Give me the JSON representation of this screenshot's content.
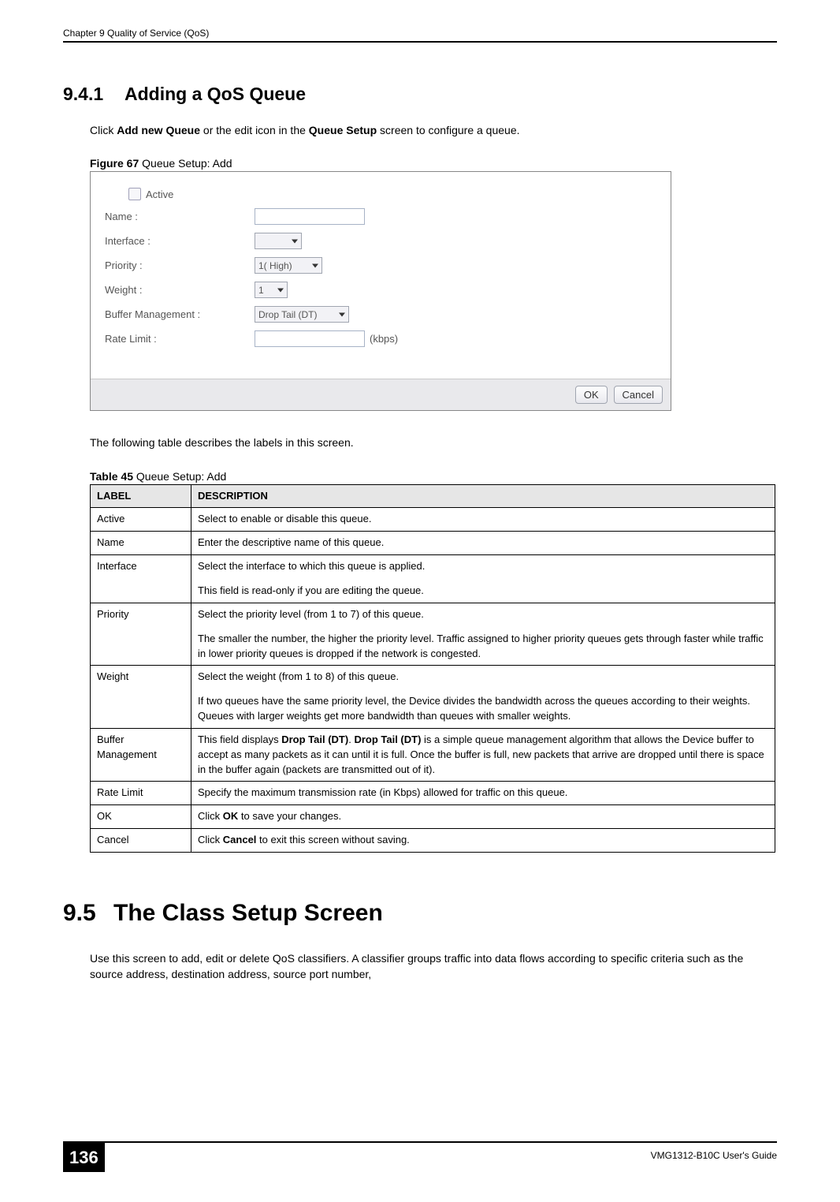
{
  "header": {
    "chapter": "Chapter 9 Quality of Service (QoS)"
  },
  "section1": {
    "number": "9.4.1",
    "title": "Adding a QoS Queue",
    "intro_pre": "Click ",
    "intro_bold1": "Add new Queue",
    "intro_mid": " or the edit icon in the ",
    "intro_bold2": "Queue Setup",
    "intro_post": " screen to configure a queue."
  },
  "figure": {
    "label": "Figure 67",
    "caption": "   Queue Setup: Add",
    "fields": {
      "active_label": "Active",
      "name_label": "Name :",
      "interface_label": "Interface :",
      "priority_label": "Priority :",
      "priority_value": "1( High)",
      "weight_label": "Weight :",
      "weight_value": "1",
      "buffer_label": "Buffer Management :",
      "buffer_value": "Drop Tail (DT)",
      "rate_label": "Rate Limit :",
      "rate_unit": "(kbps)"
    },
    "buttons": {
      "ok": "OK",
      "cancel": "Cancel"
    }
  },
  "midtext": "The following table describes the labels in this screen.",
  "table": {
    "label": "Table 45",
    "caption": "   Queue Setup: Add",
    "head_label": "LABEL",
    "head_desc": "DESCRIPTION",
    "rows": [
      {
        "label": "Active",
        "desc": "Select to enable or disable this queue."
      },
      {
        "label": "Name",
        "desc": "Enter the descriptive name of this queue."
      },
      {
        "label": "Interface",
        "desc": "Select the interface to which this queue is applied.\nThis field is read-only if you are editing the queue."
      },
      {
        "label": "Priority",
        "desc": "Select the priority level (from 1 to 7) of this queue.\nThe smaller the number, the higher the priority level. Traffic assigned to higher priority queues gets through faster while traffic in lower priority queues is dropped if the network is congested."
      },
      {
        "label": "Weight",
        "desc": "Select the weight (from 1 to 8) of this queue.\nIf two queues have the same priority level, the Device divides the bandwidth across the queues according to their weights. Queues with larger weights get more bandwidth than queues with smaller weights."
      },
      {
        "label": "Buffer Management",
        "desc_pre": "This field displays ",
        "desc_b1": "Drop Tail (DT)",
        "desc_mid": ". ",
        "desc_b2": "Drop Tail (DT)",
        "desc_post": " is a simple queue management algorithm that allows the Device buffer to accept as many packets as it can until it is full. Once the buffer is full, new packets that arrive are dropped until there is space in the buffer again (packets are transmitted out of it)."
      },
      {
        "label": "Rate Limit",
        "desc": "Specify the maximum transmission rate (in Kbps) allowed for traffic on this queue."
      },
      {
        "label": "OK",
        "desc_pre": "Click ",
        "desc_b1": "OK",
        "desc_post": " to save your changes."
      },
      {
        "label": "Cancel",
        "desc_pre": "Click ",
        "desc_b1": "Cancel",
        "desc_post": " to exit this screen without saving."
      }
    ]
  },
  "section2": {
    "number": "9.5",
    "title": "The Class Setup Screen",
    "body": "Use this screen to add, edit or delete QoS classifiers. A classifier groups traffic into data flows according to specific criteria such as the source address, destination address, source port number,"
  },
  "footer": {
    "page": "136",
    "guide": "VMG1312-B10C User's Guide"
  }
}
